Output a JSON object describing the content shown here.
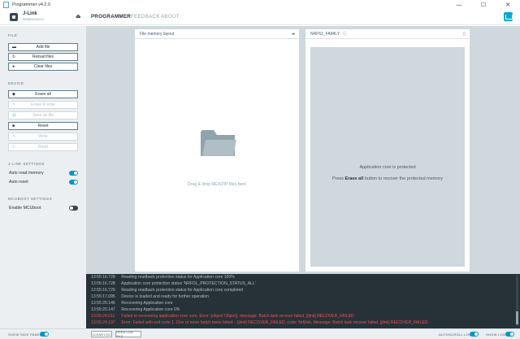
{
  "window": {
    "title": "Programmer v4.2.0",
    "controls": [
      "—",
      "☐",
      "✕"
    ]
  },
  "device": {
    "name": "J-Link",
    "serial": "000601041217"
  },
  "nav": {
    "tabs": [
      {
        "label": "PROGRAMMER"
      },
      {
        "label": "FEEDBACK"
      },
      {
        "label": "ABOUT"
      }
    ]
  },
  "sidebar": {
    "file_heading": "FILE",
    "add_file": "Add file",
    "reload_files": "Reload files",
    "clear_files": "Clear files",
    "device_heading": "DEVICE",
    "erase_all": "Erase all",
    "erase_write": "Erase & write",
    "save_as_file": "Save as file",
    "reset": "Reset",
    "write": "Write",
    "read": "Read",
    "jlink_heading": "J-LINK SETTINGS",
    "auto_read_memory": "Auto read memory",
    "auto_reset": "Auto reset",
    "mcuboot_heading": "MCUBOOT SETTINGS",
    "enable_mcuboot": "Enable MCUboot"
  },
  "file_panel": {
    "title": "File memory layout",
    "drop_text": "Drag & drop HEX/ZIP files here"
  },
  "device_panel": {
    "title": "NRF52_FAMILY",
    "protected_text": "Application core is protected",
    "press": "Press",
    "erase_all": "Erase all",
    "recover_text": "button to recover the protected memory"
  },
  "log": {
    "lines": [
      {
        "time": "13:55:16.728",
        "text": "Reading readback protection status for Application core 100%",
        "level": "info"
      },
      {
        "time": "13:55:16.728",
        "text": "Application core protection status 'NRFDL_PROTECTION_STATUS_ALL'",
        "level": "info"
      },
      {
        "time": "13:55:16.729",
        "text": "Reading readback protection status for Application core completed",
        "level": "info"
      },
      {
        "time": "13:55:17.095",
        "text": "Device is loaded and ready for further operation",
        "level": "info"
      },
      {
        "time": "13:55:20.146",
        "text": "Recovering Application core",
        "level": "info"
      },
      {
        "time": "13:55:20.147",
        "text": "Recovering Application core 0%",
        "level": "info"
      },
      {
        "time": "13:55:24.011",
        "text": "Failed to recovering application core core. Error: [object Object], message: Batch task recover failed, [jlink] RECOVER_FAILED",
        "level": "error"
      },
      {
        "time": "13:55:24.197",
        "text": "Error: Failed with exit code 1. One or more batch tasks failed: - [jlink] RECOVER_FAILED, code: Nrfjlink, Message: Batch task recover failed, [jlink] RECOVER_FAILED.",
        "level": "error"
      }
    ]
  },
  "footer": {
    "show_side_panel": "SHOW SIDE PANEL",
    "clear_log": "CLEAR LOG",
    "open_log_file": "OPEN LOG FILE",
    "autoscroll_log": "AUTOSCROLL LOG",
    "show_log": "SHOW LOG"
  },
  "colors": {
    "accent": "#0097c7",
    "error": "#ef5350",
    "sidebar_bg": "#eceff1",
    "log_bg": "#263238"
  }
}
